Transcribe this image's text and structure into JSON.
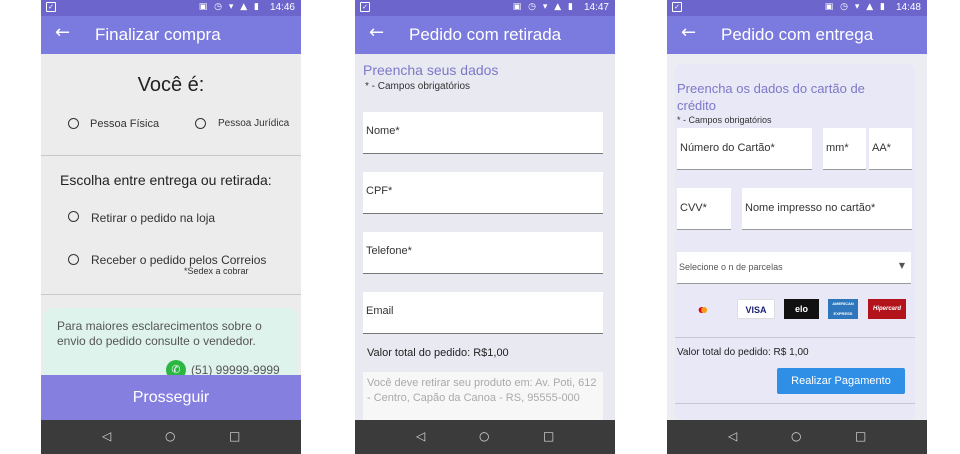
{
  "status_times": [
    "14:46",
    "14:47",
    "14:48"
  ],
  "navbar_icons": [
    "back-triangle",
    "home-circle",
    "recents-square"
  ],
  "screen1": {
    "title": "Finalizar compra",
    "question1": "Você é:",
    "options1": [
      "Pessoa Física",
      "Pessoa Jurídica"
    ],
    "question2": "Escolha entre entrega ou retirada:",
    "options2": [
      "Retirar o pedido na loja",
      "Receber o pedido pelos Correios"
    ],
    "sedex_note": "*Sedex a cobrar",
    "info_text": "Para maiores esclarecimentos sobre o envio do pedido consulte o vendedor.",
    "whatsapp_number": "(51) 99999-9999",
    "proceed_button": "Prosseguir"
  },
  "screen2": {
    "title": "Pedido com retirada",
    "form_heading": "Preencha seus dados",
    "required_note": "* - Campos obrigatórios",
    "fields": [
      "Nome*",
      "CPF*",
      "Telefone*",
      "Email"
    ],
    "total_label": "Valor total do pedido: R$1,00",
    "pickup_text": "Você deve retirar seu produto em: Av. Poti, 612 - Centro, Capão da Canoa - RS, 95555-000"
  },
  "screen3": {
    "title": "Pedido com entrega",
    "card_heading": "Preencha os dados do cartão de crédito",
    "required_note": "* - Campos obrigatórios",
    "card_number": "Número do Cartão*",
    "month": "mm*",
    "year": "AA*",
    "cvv": "CVV*",
    "name_on_card": "Nome impresso no cartão*",
    "installments_select": "Selecione o n de parcelas",
    "brands": [
      "mastercard",
      "VISA",
      "elo",
      "AMERICAN EXPRESS",
      "Hipercard"
    ],
    "total_label": "Valor total do pedido: R$ 1,00",
    "pay_button": "Realizar Pagamento"
  }
}
